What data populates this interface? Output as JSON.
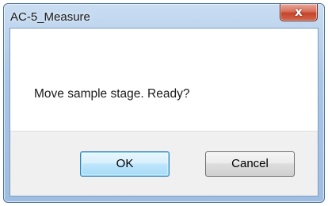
{
  "window": {
    "title": "AC-5_Measure",
    "close_glyph": "x"
  },
  "dialog": {
    "message": "Move sample stage. Ready?",
    "ok_label": "OK",
    "cancel_label": "Cancel"
  },
  "colors": {
    "titlebar": "#a9c6e6",
    "close_button": "#c5442b",
    "default_button_border": "#3c7fb1",
    "button_area": "#f0f0f0"
  }
}
